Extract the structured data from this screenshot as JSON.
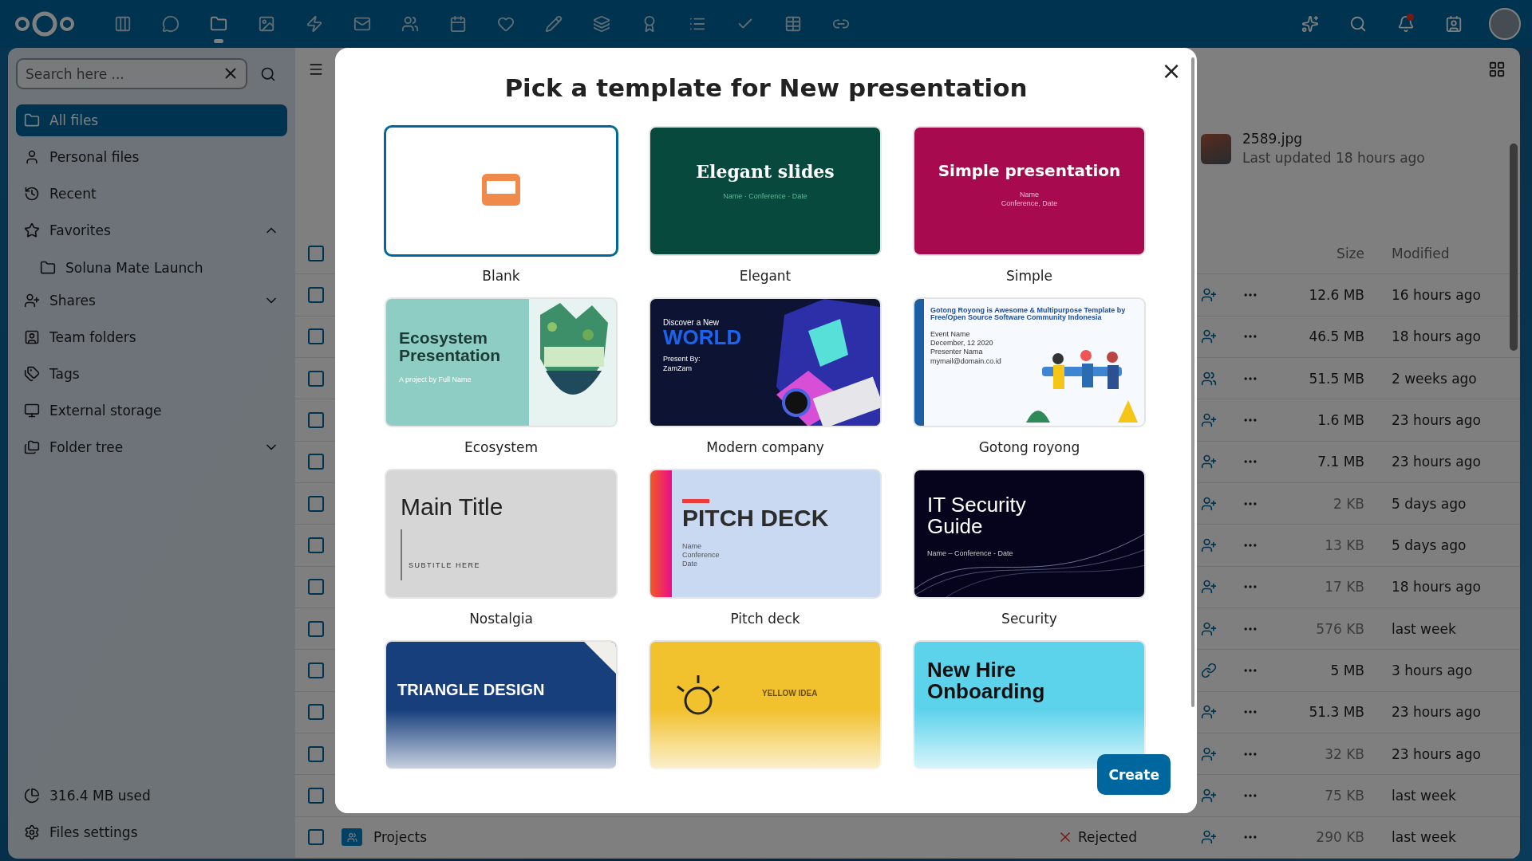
{
  "header": {
    "apps": [
      {
        "selected": false
      },
      {
        "selected": false
      },
      {
        "selected": true
      },
      {
        "selected": false
      },
      {
        "selected": false
      },
      {
        "selected": false
      },
      {
        "selected": false
      },
      {
        "selected": false
      },
      {
        "selected": false
      },
      {
        "selected": false
      },
      {
        "selected": false
      },
      {
        "selected": false
      },
      {
        "selected": false
      },
      {
        "selected": false
      },
      {
        "selected": false
      },
      {
        "selected": false
      }
    ],
    "notifications_unread": true
  },
  "sidebar": {
    "search": {
      "placeholder": "Search here ..."
    },
    "items": [
      {
        "label": "All files",
        "selected": true
      },
      {
        "label": "Personal files",
        "selected": false
      },
      {
        "label": "Recent",
        "selected": false
      },
      {
        "label": "Favorites",
        "selected": false,
        "expanded": true,
        "children": [
          {
            "label": "Soluna Mate Launch",
            "selected": false
          }
        ]
      },
      {
        "label": "Shares",
        "selected": false,
        "expanded": false
      },
      {
        "label": "Team folders",
        "selected": false
      },
      {
        "label": "Tags",
        "selected": false
      },
      {
        "label": "External storage",
        "selected": false
      },
      {
        "label": "Folder tree",
        "selected": false,
        "expanded": false
      }
    ],
    "quota": "316.4 MB used",
    "settings": "Files settings"
  },
  "recent": {
    "name": "2589.jpg",
    "updated": "Last updated 18 hours ago"
  },
  "table": {
    "select_all_checked": false,
    "columns": [
      "Size",
      "Modified"
    ],
    "rows": [
      {
        "checked": false,
        "kind": "add",
        "size": "12.6 MB",
        "modified": "16 hours ago"
      },
      {
        "checked": false,
        "kind": "add",
        "size": "46.5 MB",
        "modified": "18 hours ago"
      },
      {
        "checked": false,
        "kind": "group",
        "size": "51.5 MB",
        "modified": "2 weeks ago"
      },
      {
        "checked": false,
        "kind": "add",
        "size": "1.6 MB",
        "modified": "23 hours ago"
      },
      {
        "checked": false,
        "kind": "add",
        "size": "7.1 MB",
        "modified": "23 hours ago"
      },
      {
        "checked": false,
        "kind": "add",
        "size": "2 KB",
        "modified": "5 days ago"
      },
      {
        "checked": false,
        "kind": "add",
        "size": "13 KB",
        "modified": "5 days ago"
      },
      {
        "checked": false,
        "kind": "add",
        "size": "17 KB",
        "modified": "18 hours ago"
      },
      {
        "checked": false,
        "kind": "add",
        "size": "576 KB",
        "modified": "last week"
      },
      {
        "checked": false,
        "kind": "link",
        "size": "5 MB",
        "modified": "3 hours ago"
      },
      {
        "checked": false,
        "kind": "add",
        "size": "51.3 MB",
        "modified": "23 hours ago"
      },
      {
        "checked": false,
        "kind": "add",
        "size": "32 KB",
        "modified": "23 hours ago"
      },
      {
        "checked": false,
        "kind": "add",
        "size": "75 KB",
        "modified": "last week"
      },
      {
        "checked": false,
        "kind": "add",
        "name": "Projects",
        "status": "Rejected",
        "size": "290 KB",
        "modified": "last week"
      }
    ]
  },
  "dialog": {
    "title": "Pick a template for New presentation",
    "close": "×",
    "templates": [
      {
        "label": "Blank",
        "selected": true,
        "preview": {
          "kind": "blank"
        }
      },
      {
        "label": "Elegant",
        "selected": false,
        "preview": {
          "kind": "elegant",
          "title": "Elegant slides",
          "lines": [
            "Name · Conference · Date"
          ]
        }
      },
      {
        "label": "Simple",
        "selected": false,
        "preview": {
          "kind": "simple",
          "title": "Simple presentation",
          "lines": [
            "Name",
            "Conference, Date"
          ]
        }
      },
      {
        "label": "Ecosystem",
        "selected": false,
        "preview": {
          "kind": "ecosystem",
          "title": "Ecosystem Presentation",
          "lines": [
            "A project by Full Name"
          ]
        }
      },
      {
        "label": "Modern company",
        "selected": false,
        "preview": {
          "kind": "modern",
          "kicker": "Discover a New",
          "title": "WORLD",
          "lines": [
            "Present By:",
            "ZamZam"
          ]
        }
      },
      {
        "label": "Gotong royong",
        "selected": false,
        "preview": {
          "kind": "gotong",
          "title": "Gotong Royong is Awesome & Multipurpose Template by Free/Open Source Software Community Indonesia",
          "lines": [
            "Event Name",
            "December, 12 2020",
            "Presenter Nama",
            "mymail@domain.co.id"
          ]
        }
      },
      {
        "label": "Nostalgia",
        "selected": false,
        "preview": {
          "kind": "nostalgia",
          "title": "Main Title",
          "lines": [
            "SUBTITLE HERE"
          ]
        }
      },
      {
        "label": "Pitch deck",
        "selected": false,
        "preview": {
          "kind": "pitch",
          "title": "PITCH DECK",
          "lines": [
            "Name",
            "Conference",
            "Date"
          ]
        }
      },
      {
        "label": "Security",
        "selected": false,
        "preview": {
          "kind": "security",
          "title": "IT Security Guide",
          "lines": [
            "Name – Conference - Date"
          ]
        }
      },
      {
        "selected": false,
        "preview": {
          "kind": "triangle",
          "title": "TRIANGLE DESIGN"
        }
      },
      {
        "selected": false,
        "preview": {
          "kind": "yellow",
          "title": "YELLOW IDEA"
        }
      },
      {
        "selected": false,
        "preview": {
          "kind": "newhire",
          "title": "New Hire Onboarding"
        }
      }
    ],
    "create": "Create"
  }
}
